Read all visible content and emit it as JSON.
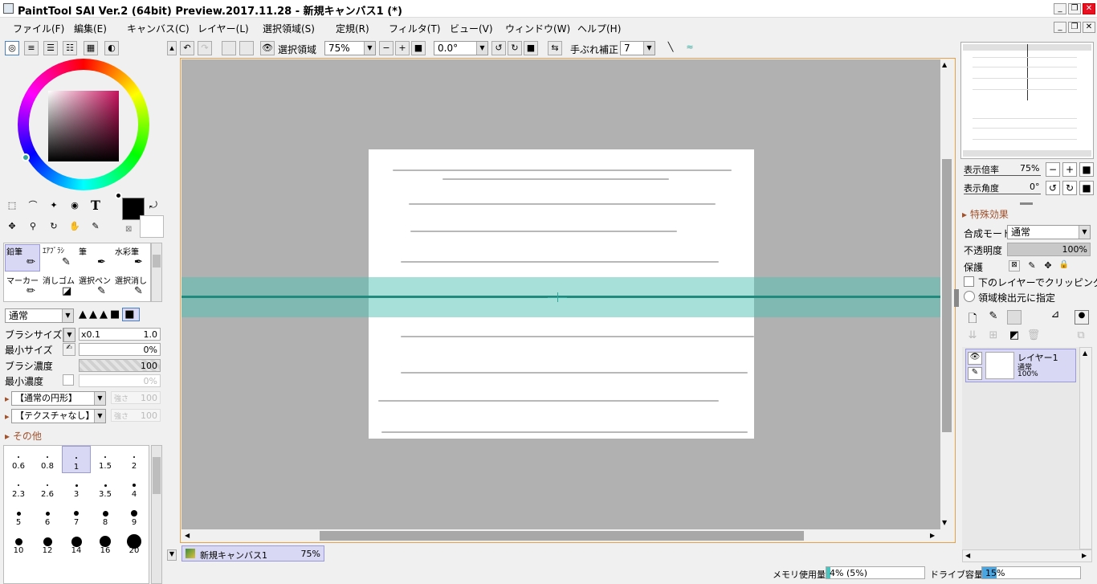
{
  "window": {
    "title": "PaintTool SAI Ver.2 (64bit) Preview.2017.11.28 - 新規キャンバス1 (*)"
  },
  "menu": [
    "ファイル(F)",
    "編集(E)",
    "キャンバス(C)",
    "レイヤー(L)",
    "選択領域(S)",
    "定規(R)",
    "フィルタ(T)",
    "ビュー(V)",
    "ウィンドウ(W)",
    "ヘルプ(H)"
  ],
  "toolbar": {
    "selection_label": "選択領域",
    "zoom": "75%",
    "angle": "0.0°",
    "stabilizer_label": "手ぶれ補正",
    "stabilizer": "7"
  },
  "tools": {
    "brushes": [
      [
        "鉛筆",
        "ｴｱﾌﾞﾗｼ",
        "筆",
        "水彩筆"
      ],
      [
        "マーカー",
        "消しゴム",
        "選択ペン",
        "選択消し"
      ]
    ],
    "text_tool_glyph": "T"
  },
  "brush": {
    "blend_mode": "通常",
    "size_label": "ブラシサイズ",
    "size_mult": "x0.1",
    "size": "1.0",
    "min_size_label": "最小サイズ",
    "min_size": "0%",
    "density_label": "ブラシ濃度",
    "density": "100",
    "min_density_label": "最小濃度",
    "min_density": "0%",
    "shape": "【通常の円形】",
    "shape_strength_label": "強さ",
    "shape_strength": "100",
    "texture": "【テクスチャなし】",
    "texture_strength_label": "強さ",
    "texture_strength": "100",
    "other_label": "その他",
    "sizes": [
      "0.6",
      "0.8",
      "1",
      "1.5",
      "2",
      "2.3",
      "2.6",
      "3",
      "3.5",
      "4",
      "5",
      "6",
      "7",
      "8",
      "9",
      "10",
      "12",
      "14",
      "16",
      "20"
    ]
  },
  "navigator": {
    "zoom_label": "表示倍率",
    "zoom": "75%",
    "angle_label": "表示角度",
    "angle": "0°"
  },
  "layer_panel": {
    "effects_label": "特殊効果",
    "blend_label": "合成モード",
    "blend": "通常",
    "opacity_label": "不透明度",
    "opacity": "100%",
    "protect_label": "保護",
    "clip_label": "下のレイヤーでクリッピング",
    "source_label": "領域検出元に指定",
    "layers": [
      {
        "name": "レイヤー1",
        "mode": "通常",
        "opacity": "100%"
      }
    ]
  },
  "doc_tab": {
    "name": "新規キャンバス1",
    "zoom": "75%"
  },
  "status": {
    "memory_label": "メモリ使用量",
    "memory": "4% (5%)",
    "memory_fill": 0.04,
    "drive_label": "ドライブ容量",
    "drive": "15%",
    "drive_fill": 0.15
  },
  "colors": {
    "accent": "#2fa79a",
    "selection_band": "#4fc2b1",
    "canvas_bg": "#b1b1b1",
    "paper": "#ffffff"
  }
}
